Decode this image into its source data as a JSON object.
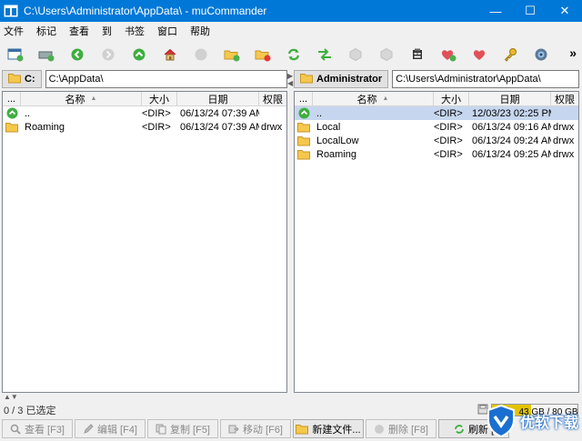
{
  "window": {
    "title": "C:\\Users\\Administrator\\AppData\\ - muCommander",
    "minimize": "—",
    "maximize": "☐",
    "close": "✕"
  },
  "menu": [
    "文件",
    "标记",
    "查看",
    "到",
    "书签",
    "窗口",
    "帮助"
  ],
  "toolbar": {
    "more": "»",
    "icons": [
      "new-window-icon",
      "connect-server-icon",
      "back-icon",
      "forward-icon",
      "parent-folder-icon",
      "home-icon",
      "stop-icon",
      "mark-folder-icon",
      "unmark-folder-icon",
      "refresh-icon",
      "swap-panels-icon",
      "pack-icon",
      "unpack-icon",
      "email-icon",
      "add-bookmark-icon",
      "edit-bookmarks-icon",
      "credentials-icon",
      "preferences-icon"
    ]
  },
  "left_panel": {
    "drive": "C:",
    "path": "C:\\AppData\\",
    "columns": {
      "ext": "...",
      "name": "名称",
      "size": "大小",
      "date": "日期",
      "perm": "权限"
    },
    "rows": [
      {
        "icon": "parent",
        "name": "..",
        "size": "<DIR>",
        "date": "06/13/24 07:39 AM",
        "perm": ""
      },
      {
        "icon": "folder",
        "name": "Roaming",
        "size": "<DIR>",
        "date": "06/13/24 07:39 AM",
        "perm": "drwx"
      }
    ]
  },
  "right_panel": {
    "drive": "Administrator",
    "path": "C:\\Users\\Administrator\\AppData\\",
    "columns": {
      "ext": "...",
      "name": "名称",
      "size": "大小",
      "date": "日期",
      "perm": "权限"
    },
    "rows": [
      {
        "icon": "parent",
        "name": "..",
        "size": "<DIR>",
        "date": "12/03/23 02:25 PM",
        "perm": "",
        "selected": true
      },
      {
        "icon": "folder",
        "name": "Local",
        "size": "<DIR>",
        "date": "06/13/24 09:16 AM",
        "perm": "drwx"
      },
      {
        "icon": "folder",
        "name": "LocalLow",
        "size": "<DIR>",
        "date": "06/13/24 09:24 AM",
        "perm": "drwx"
      },
      {
        "icon": "folder",
        "name": "Roaming",
        "size": "<DIR>",
        "date": "06/13/24 09:25 AM",
        "perm": "drwx"
      }
    ]
  },
  "status": {
    "selection": "0 / 3 已选定",
    "disk": "空闲：43 GB / 80 GB",
    "disk_used_fraction": 0.46
  },
  "buttons": [
    {
      "label": "查看 [F3]",
      "enabled": false,
      "icon": "view-icon"
    },
    {
      "label": "编辑 [F4]",
      "enabled": false,
      "icon": "edit-icon"
    },
    {
      "label": "复制 [F5]",
      "enabled": false,
      "icon": "copy-icon"
    },
    {
      "label": "移动 [F6]",
      "enabled": false,
      "icon": "move-icon"
    },
    {
      "label": "新建文件...",
      "enabled": true,
      "icon": "new-folder-icon"
    },
    {
      "label": "删除 [F8]",
      "enabled": false,
      "icon": "delete-icon"
    },
    {
      "label": "刷新 [",
      "enabled": true,
      "icon": "refresh-icon"
    }
  ],
  "watermark": {
    "text": "优软下载"
  },
  "colors": {
    "titlebar": "#0078d7",
    "selection": "#c6d6ee",
    "folder": "#f5c84c",
    "parent": "#3fae3f",
    "disk_fill": "#e3c400"
  }
}
